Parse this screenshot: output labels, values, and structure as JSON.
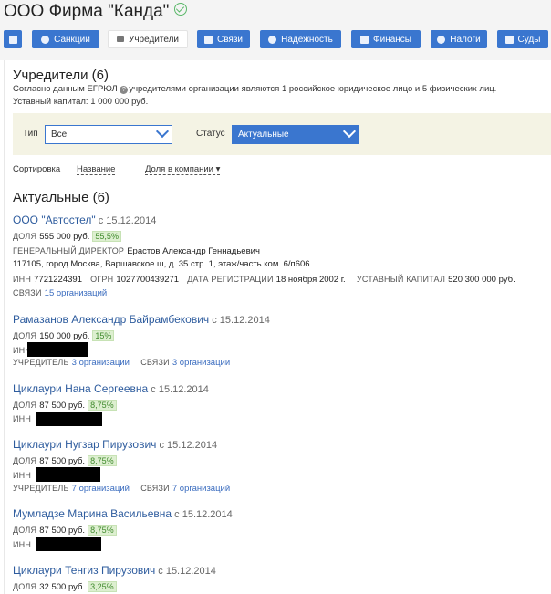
{
  "company": {
    "name": "ООО Фирма \"Канда\""
  },
  "tabs": [
    {
      "label": ""
    },
    {
      "label": "Санкции"
    },
    {
      "label": "Учредители"
    },
    {
      "label": "Связи"
    },
    {
      "label": "Надежность"
    },
    {
      "label": "Финансы"
    },
    {
      "label": "Налоги"
    },
    {
      "label": "Суды"
    }
  ],
  "section": {
    "title": "Учредители (6)",
    "desc_pre": "Согласно данным ЕГРЮЛ",
    "desc_post": "учредителями организации являются 1 российское юридическое лицо и 5 физических лиц.",
    "capital": "Уставный капитал: 1 000 000 руб."
  },
  "filters": {
    "type_label": "Тип",
    "type_value": "Все",
    "status_label": "Статус",
    "status_value": "Актуальные"
  },
  "sort": {
    "label": "Сортировка",
    "by_name": "Название",
    "by_share": "Доля в компании ▾"
  },
  "group_title": "Актуальные (6)",
  "labels": {
    "share": "ДОЛЯ",
    "inn": "ИНН",
    "ogrn": "ОГРН",
    "reg_date": "ДАТА РЕГИСТРАЦИИ",
    "capital": "УСТАВНЫЙ КАПИТАЛ",
    "links": "СВЯЗИ",
    "founder": "УЧРЕДИТЕЛЬ",
    "director": "ГЕНЕРАЛЬНЫЙ ДИРЕКТОР"
  },
  "founders": [
    {
      "name": "ООО \"Автостел\"",
      "since": "с 15.12.2014",
      "share": "555 000 руб.",
      "pct": "55,5%",
      "director": "Ерастов Александр Геннадьевич",
      "address": "117105, город Москва, Варшавское ш, д. 35 стр. 1, этаж/часть ком. 6/п606",
      "inn": "7721224391",
      "ogrn": "1027700439271",
      "reg_date": "18 ноября 2002 г.",
      "capital": "520 300 000 руб.",
      "links": "15 организаций"
    },
    {
      "name": "Рамазанов Александр Байрамбекович",
      "since": "с 15.12.2014",
      "share": "150 000 руб.",
      "pct": "15%",
      "founder_of": "3 организации",
      "links": "3 организации"
    },
    {
      "name": "Циклаури Нана Сергеевна",
      "since": "с 15.12.2014",
      "share": "87 500 руб.",
      "pct": "8,75%"
    },
    {
      "name": "Циклаури Нугзар Пирузович",
      "since": "с 15.12.2014",
      "share": "87 500 руб.",
      "pct": "8,75%",
      "founder_of": "7 организаций",
      "links": "7 организаций"
    },
    {
      "name": "Мумладзе Марина Васильевна",
      "since": "с 15.12.2014",
      "share": "87 500 руб.",
      "pct": "8,75%"
    },
    {
      "name": "Циклаури Тенгиз Пирузович",
      "since": "с 15.12.2014",
      "share": "32 500 руб.",
      "pct": "3,25%"
    }
  ]
}
